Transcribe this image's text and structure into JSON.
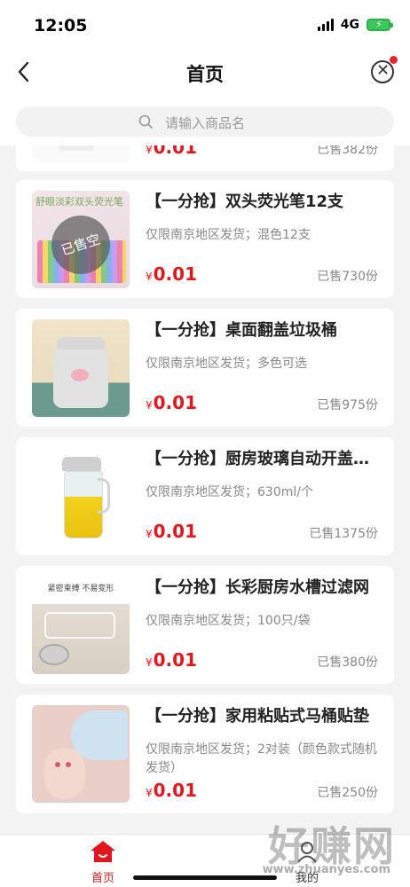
{
  "status_bar": {
    "time": "12:05",
    "network": "4G"
  },
  "nav": {
    "title": "首页"
  },
  "search": {
    "placeholder": "请输入商品名"
  },
  "products": [
    {
      "name": "",
      "desc": "",
      "currency": "¥",
      "price": "0.01",
      "sold": "已售382份"
    },
    {
      "name": "【一分抢】双头荧光笔12支",
      "desc": "仅限南京地区发货；混色12支",
      "currency": "¥",
      "price": "0.01",
      "sold": "已售730份",
      "badge": "已售空",
      "image_text": "舒眼淡彩双头荧光笔"
    },
    {
      "name": "【一分抢】桌面翻盖垃圾桶",
      "desc": "仅限南京地区发货；多色可选",
      "currency": "¥",
      "price": "0.01",
      "sold": "已售975份"
    },
    {
      "name": "【一分抢】厨房玻璃自动开盖油壶",
      "desc": "仅限南京地区发货；630ml/个",
      "currency": "¥",
      "price": "0.01",
      "sold": "已售1375份"
    },
    {
      "name": "【一分抢】长彩厨房水槽过滤网",
      "desc": "仅限南京地区发货；100只/袋",
      "currency": "¥",
      "price": "0.01",
      "sold": "已售380份",
      "image_text": "紧密束缚 不易变形"
    },
    {
      "name": "【一分抢】家用粘贴式马桶贴垫",
      "desc": "仅限南京地区发货；2对装（颜色款式随机发货）",
      "currency": "¥",
      "price": "0.01",
      "sold": "已售250份"
    }
  ],
  "tabbar": {
    "home_label": "首页",
    "mine_label": "我的"
  },
  "watermark": {
    "main": "好赚网",
    "sub": "www.zhuanyes.com"
  },
  "colors": {
    "accent": "#e0181e",
    "background": "#f3f3f3"
  },
  "icons": [
    "back-arrow-icon",
    "close-circle-icon",
    "search-icon",
    "home-icon",
    "user-icon"
  ]
}
